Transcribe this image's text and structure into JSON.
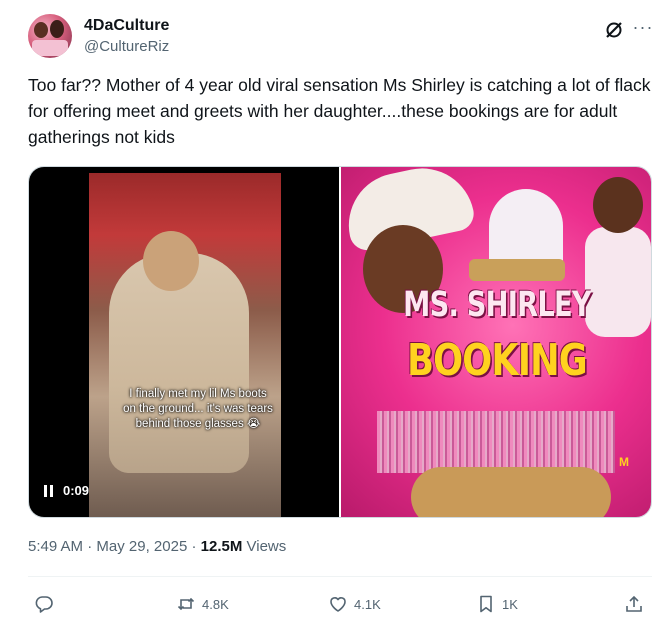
{
  "author": {
    "display_name": "4DaCulture",
    "handle": "@CultureRiz"
  },
  "icons": {
    "grok": "grok-icon",
    "more": "more-icon"
  },
  "tweet": {
    "text": "Too far?? Mother of 4 year old viral sensation Ms Shirley is catching a lot of flack for offering meet and greets with her daughter....these bookings are for adult gatherings not kids"
  },
  "media": {
    "video": {
      "caption": "I finally met my lil Ms boots on the ground... it's was tears behind those glasses 😭",
      "time": "0:09"
    },
    "poster": {
      "title_line1": "MS. SHIRLEY",
      "title_line2": "BOOKING",
      "edge_letter": "M"
    }
  },
  "meta": {
    "time": "5:49 AM",
    "separator": "·",
    "date": "May 29, 2025",
    "views_count": "12.5M",
    "views_label": "Views"
  },
  "actions": {
    "reply": {
      "icon": "reply-icon",
      "count": ""
    },
    "retweet": {
      "icon": "retweet-icon",
      "count": "4.8K"
    },
    "like": {
      "icon": "heart-icon",
      "count": "4.1K"
    },
    "bookmark": {
      "icon": "bookmark-icon",
      "count": "1K"
    },
    "share": {
      "icon": "share-icon",
      "count": ""
    }
  },
  "colors": {
    "text": "#0f1419",
    "secondary": "#536471",
    "border": "#cfd9de",
    "poster_pink": "#ec2f8e",
    "poster_yellow": "#ffd21f"
  }
}
